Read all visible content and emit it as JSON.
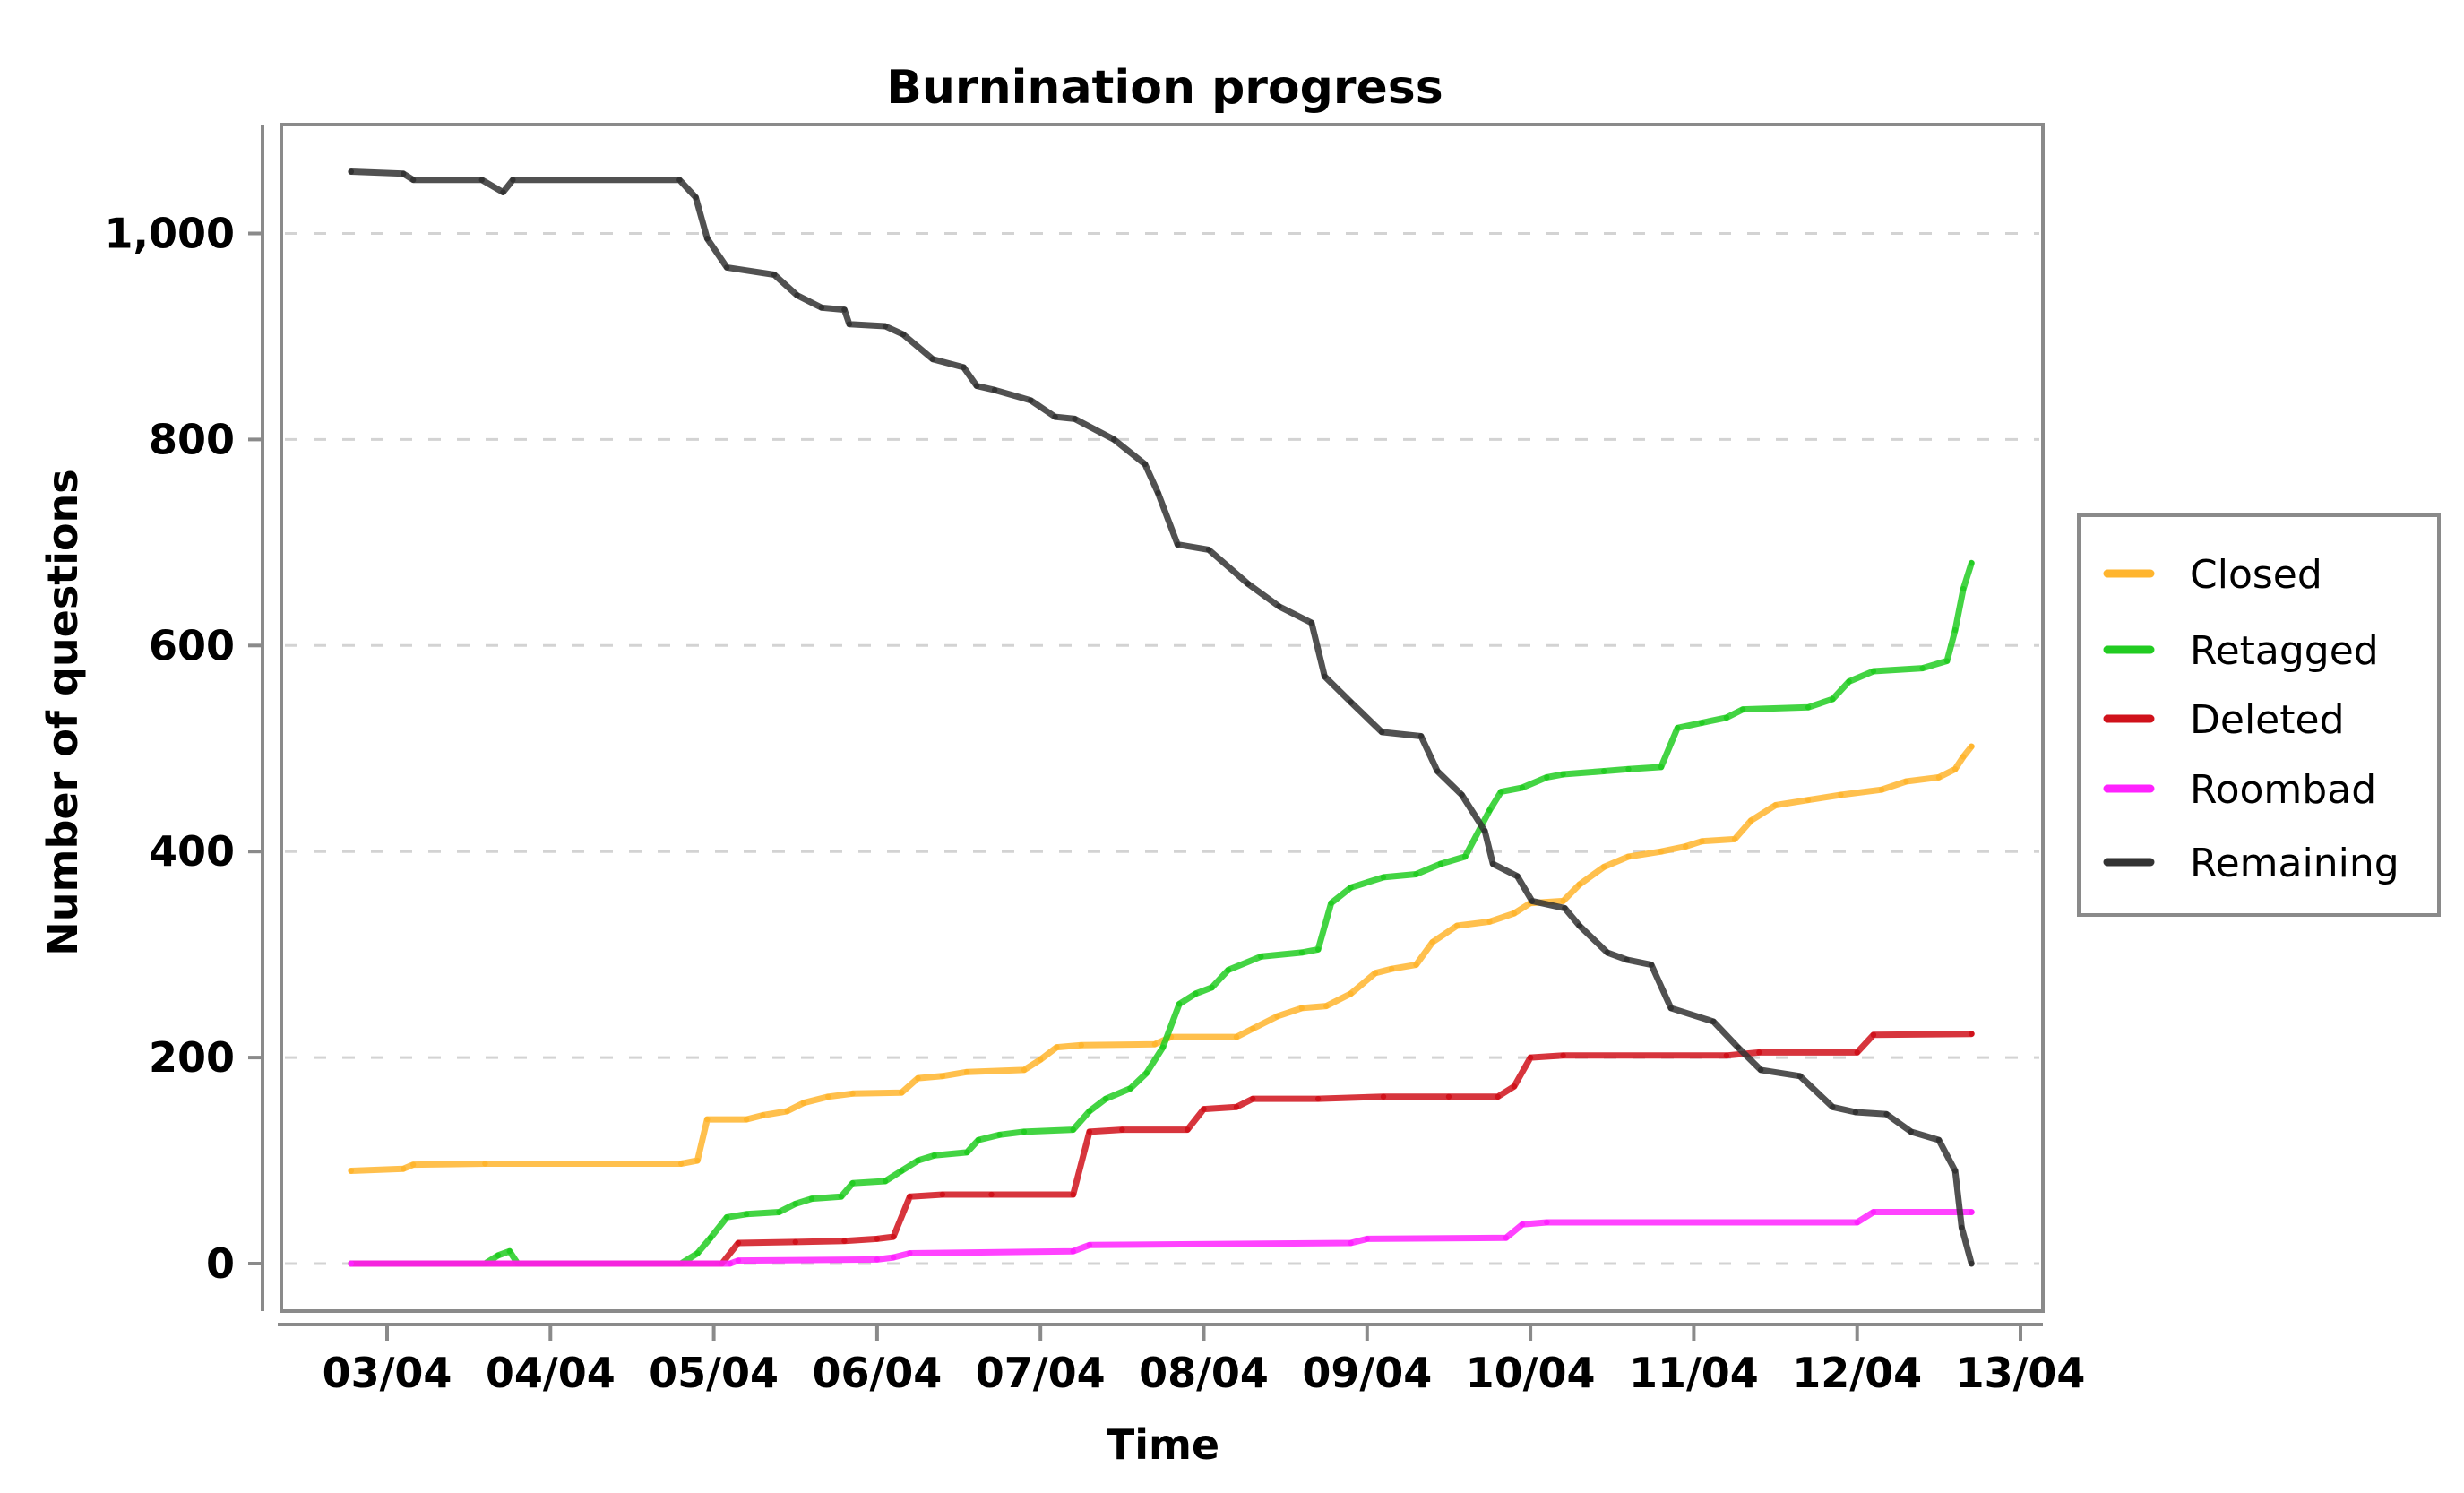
{
  "chart_data": {
    "type": "line",
    "title": "Burnination progress",
    "xlabel": "Time",
    "ylabel": "Number of questions",
    "x_units": "days since 03/04",
    "xlim": [
      -0.75,
      10.05
    ],
    "ylim": [
      -70,
      1100
    ],
    "x_ticks": [
      {
        "value": 0,
        "label": "03/04"
      },
      {
        "value": 1,
        "label": "04/04"
      },
      {
        "value": 2,
        "label": "05/04"
      },
      {
        "value": 3,
        "label": "06/04"
      },
      {
        "value": 4,
        "label": "07/04"
      },
      {
        "value": 5,
        "label": "08/04"
      },
      {
        "value": 6,
        "label": "09/04"
      },
      {
        "value": 7,
        "label": "10/04"
      },
      {
        "value": 8,
        "label": "11/04"
      },
      {
        "value": 9,
        "label": "12/04"
      },
      {
        "value": 10,
        "label": "13/04"
      }
    ],
    "y_ticks": [
      {
        "value": 0,
        "label": "0"
      },
      {
        "value": 200,
        "label": "200"
      },
      {
        "value": 400,
        "label": "400"
      },
      {
        "value": 600,
        "label": "600"
      },
      {
        "value": 800,
        "label": "800"
      },
      {
        "value": 1000,
        "label": "1,000"
      }
    ],
    "grid": "horizontal-dashed",
    "legend_position": "right",
    "series": [
      {
        "name": "Closed",
        "color": "#FFB52E",
        "points": [
          [
            -0.22,
            90
          ],
          [
            0.1,
            92
          ],
          [
            0.16,
            96
          ],
          [
            0.6,
            97
          ],
          [
            1.8,
            97
          ],
          [
            1.9,
            100
          ],
          [
            1.96,
            140
          ],
          [
            2.2,
            140
          ],
          [
            2.3,
            144
          ],
          [
            2.45,
            148
          ],
          [
            2.55,
            156
          ],
          [
            2.7,
            162
          ],
          [
            2.85,
            165
          ],
          [
            3.15,
            166
          ],
          [
            3.25,
            180
          ],
          [
            3.4,
            182
          ],
          [
            3.55,
            186
          ],
          [
            3.9,
            188
          ],
          [
            4.0,
            198
          ],
          [
            4.1,
            210
          ],
          [
            4.25,
            212
          ],
          [
            4.7,
            213
          ],
          [
            4.8,
            220
          ],
          [
            5.2,
            220
          ],
          [
            5.3,
            228
          ],
          [
            5.45,
            240
          ],
          [
            5.6,
            248
          ],
          [
            5.75,
            250
          ],
          [
            5.9,
            262
          ],
          [
            6.05,
            282
          ],
          [
            6.15,
            286
          ],
          [
            6.3,
            290
          ],
          [
            6.4,
            312
          ],
          [
            6.55,
            328
          ],
          [
            6.75,
            332
          ],
          [
            6.9,
            340
          ],
          [
            7.0,
            350
          ],
          [
            7.2,
            352
          ],
          [
            7.3,
            368
          ],
          [
            7.45,
            385
          ],
          [
            7.6,
            395
          ],
          [
            7.8,
            400
          ],
          [
            7.95,
            405
          ],
          [
            8.05,
            410
          ],
          [
            8.25,
            412
          ],
          [
            8.35,
            430
          ],
          [
            8.5,
            445
          ],
          [
            8.7,
            450
          ],
          [
            8.9,
            455
          ],
          [
            9.15,
            460
          ],
          [
            9.3,
            468
          ],
          [
            9.5,
            472
          ],
          [
            9.6,
            480
          ],
          [
            9.65,
            492
          ],
          [
            9.7,
            502
          ]
        ]
      },
      {
        "name": "Retagged",
        "color": "#22CC22",
        "points": [
          [
            -0.22,
            0
          ],
          [
            0.6,
            0
          ],
          [
            0.68,
            8
          ],
          [
            0.75,
            12
          ],
          [
            0.8,
            0
          ],
          [
            1.8,
            0
          ],
          [
            1.9,
            10
          ],
          [
            1.98,
            25
          ],
          [
            2.08,
            45
          ],
          [
            2.2,
            48
          ],
          [
            2.4,
            50
          ],
          [
            2.5,
            58
          ],
          [
            2.6,
            63
          ],
          [
            2.78,
            65
          ],
          [
            2.85,
            78
          ],
          [
            3.05,
            80
          ],
          [
            3.15,
            90
          ],
          [
            3.25,
            100
          ],
          [
            3.35,
            105
          ],
          [
            3.55,
            108
          ],
          [
            3.62,
            120
          ],
          [
            3.75,
            125
          ],
          [
            3.9,
            128
          ],
          [
            4.2,
            130
          ],
          [
            4.3,
            148
          ],
          [
            4.4,
            160
          ],
          [
            4.55,
            170
          ],
          [
            4.65,
            185
          ],
          [
            4.75,
            210
          ],
          [
            4.85,
            252
          ],
          [
            4.95,
            262
          ],
          [
            5.05,
            268
          ],
          [
            5.15,
            285
          ],
          [
            5.35,
            298
          ],
          [
            5.6,
            302
          ],
          [
            5.7,
            305
          ],
          [
            5.78,
            350
          ],
          [
            5.9,
            365
          ],
          [
            6.1,
            375
          ],
          [
            6.3,
            378
          ],
          [
            6.45,
            388
          ],
          [
            6.6,
            395
          ],
          [
            6.75,
            440
          ],
          [
            6.82,
            458
          ],
          [
            6.95,
            462
          ],
          [
            7.1,
            472
          ],
          [
            7.2,
            475
          ],
          [
            7.45,
            478
          ],
          [
            7.6,
            480
          ],
          [
            7.8,
            482
          ],
          [
            7.9,
            520
          ],
          [
            8.05,
            525
          ],
          [
            8.2,
            530
          ],
          [
            8.3,
            538
          ],
          [
            8.7,
            540
          ],
          [
            8.85,
            548
          ],
          [
            8.95,
            565
          ],
          [
            9.1,
            575
          ],
          [
            9.4,
            578
          ],
          [
            9.55,
            585
          ],
          [
            9.6,
            615
          ],
          [
            9.65,
            655
          ],
          [
            9.7,
            680
          ]
        ]
      },
      {
        "name": "Deleted",
        "color": "#D0121B",
        "points": [
          [
            -0.22,
            0
          ],
          [
            2.05,
            0
          ],
          [
            2.15,
            20
          ],
          [
            2.5,
            21
          ],
          [
            2.8,
            22
          ],
          [
            3.0,
            24
          ],
          [
            3.1,
            26
          ],
          [
            3.2,
            65
          ],
          [
            3.4,
            67
          ],
          [
            3.7,
            67
          ],
          [
            4.2,
            67
          ],
          [
            4.3,
            128
          ],
          [
            4.5,
            130
          ],
          [
            4.9,
            130
          ],
          [
            5.0,
            150
          ],
          [
            5.2,
            152
          ],
          [
            5.3,
            160
          ],
          [
            5.7,
            160
          ],
          [
            6.1,
            162
          ],
          [
            6.5,
            162
          ],
          [
            6.8,
            162
          ],
          [
            6.9,
            172
          ],
          [
            7.0,
            200
          ],
          [
            7.2,
            202
          ],
          [
            8.2,
            202
          ],
          [
            8.4,
            205
          ],
          [
            9.0,
            205
          ],
          [
            9.1,
            222
          ],
          [
            9.7,
            223
          ]
        ]
      },
      {
        "name": "Roombad",
        "color": "#FF22FF",
        "points": [
          [
            -0.22,
            0
          ],
          [
            2.1,
            0
          ],
          [
            2.15,
            3
          ],
          [
            3.0,
            4
          ],
          [
            3.1,
            6
          ],
          [
            3.2,
            10
          ],
          [
            4.2,
            12
          ],
          [
            4.3,
            18
          ],
          [
            5.9,
            20
          ],
          [
            6.0,
            24
          ],
          [
            6.85,
            25
          ],
          [
            6.95,
            38
          ],
          [
            7.1,
            40
          ],
          [
            9.0,
            40
          ],
          [
            9.1,
            50
          ],
          [
            9.7,
            50
          ]
        ]
      },
      {
        "name": "Remaining",
        "color": "#333333",
        "points": [
          [
            -0.22,
            1060
          ],
          [
            0.1,
            1058
          ],
          [
            0.16,
            1052
          ],
          [
            0.58,
            1052
          ],
          [
            0.71,
            1040
          ],
          [
            0.77,
            1052
          ],
          [
            1.79,
            1052
          ],
          [
            1.89,
            1035
          ],
          [
            1.96,
            995
          ],
          [
            2.08,
            967
          ],
          [
            2.37,
            960
          ],
          [
            2.51,
            940
          ],
          [
            2.66,
            928
          ],
          [
            2.8,
            926
          ],
          [
            2.83,
            912
          ],
          [
            3.05,
            910
          ],
          [
            3.16,
            902
          ],
          [
            3.34,
            878
          ],
          [
            3.53,
            870
          ],
          [
            3.61,
            852
          ],
          [
            3.72,
            848
          ],
          [
            3.94,
            838
          ],
          [
            4.09,
            822
          ],
          [
            4.21,
            820
          ],
          [
            4.45,
            800
          ],
          [
            4.64,
            776
          ],
          [
            4.72,
            748
          ],
          [
            4.84,
            698
          ],
          [
            5.03,
            693
          ],
          [
            5.27,
            660
          ],
          [
            5.46,
            638
          ],
          [
            5.66,
            622
          ],
          [
            5.74,
            570
          ],
          [
            5.9,
            545
          ],
          [
            6.09,
            516
          ],
          [
            6.33,
            512
          ],
          [
            6.43,
            478
          ],
          [
            6.58,
            455
          ],
          [
            6.72,
            420
          ],
          [
            6.77,
            388
          ],
          [
            6.92,
            376
          ],
          [
            7.01,
            352
          ],
          [
            7.21,
            345
          ],
          [
            7.3,
            328
          ],
          [
            7.47,
            302
          ],
          [
            7.59,
            295
          ],
          [
            7.74,
            290
          ],
          [
            7.86,
            248
          ],
          [
            8.12,
            235
          ],
          [
            8.27,
            210
          ],
          [
            8.41,
            188
          ],
          [
            8.65,
            182
          ],
          [
            8.85,
            152
          ],
          [
            8.99,
            147
          ],
          [
            9.18,
            145
          ],
          [
            9.33,
            128
          ],
          [
            9.5,
            120
          ],
          [
            9.6,
            90
          ],
          [
            9.64,
            35
          ],
          [
            9.7,
            0
          ]
        ]
      }
    ]
  }
}
